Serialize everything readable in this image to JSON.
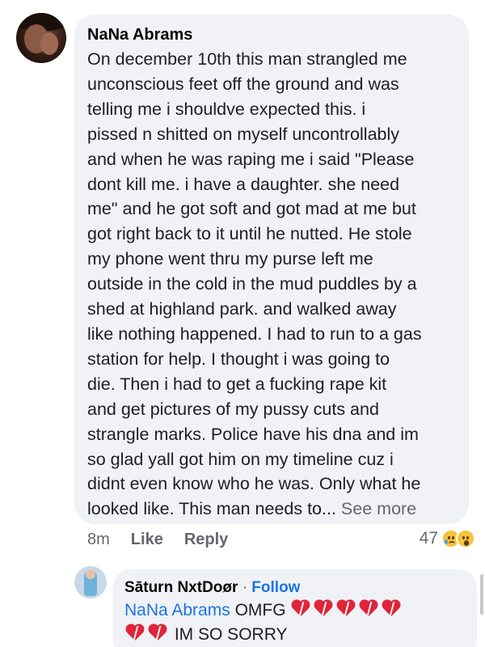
{
  "comment": {
    "author": "NaNa Abrams",
    "lines": [
      "On december 10th this man strangled me",
      "unconscious feet off the ground and was",
      "telling me i shouldve expected this. i",
      "pissed n shitted on myself uncontrollably",
      "and when he was raping me i said \"Please",
      "dont kill me. i have a daughter. she need",
      "me\" and he got soft and got mad at me but",
      "got right back to it until he nutted. He stole",
      "my phone went thru my purse left me",
      "outside in the cold in the mud puddles by a",
      "shed at highland park. and walked away",
      "like nothing happened. I had to run to a gas",
      "station for help. I thought i was going to",
      "die. Then i had to get a fucking rape kit",
      "and get pictures of my pussy cuts and",
      "strangle marks. Police have his dna and im",
      "so glad yall got him on my timeline cuz i",
      "didnt even know who he was. Only what he",
      "looked like. This man needs to..."
    ],
    "see_more": "See more",
    "time": "8m",
    "like_label": "Like",
    "reply_label": "Reply",
    "reaction_count": "47",
    "reaction_icons": [
      "sad-face-icon",
      "wow-face-icon"
    ]
  },
  "reply": {
    "author": "Sāturn NxtDoør",
    "separator": "·",
    "follow_label": "Follow",
    "mention": "NaNa Abrams",
    "text_1": "OMFG",
    "hearts_line1": 5,
    "hearts_line2": 2,
    "text_2": "IM SO SORRY"
  },
  "colors": {
    "bubble": "#f0f2f5",
    "link": "#1b74e4",
    "meta": "#65676b",
    "heart": "#e0243a"
  }
}
